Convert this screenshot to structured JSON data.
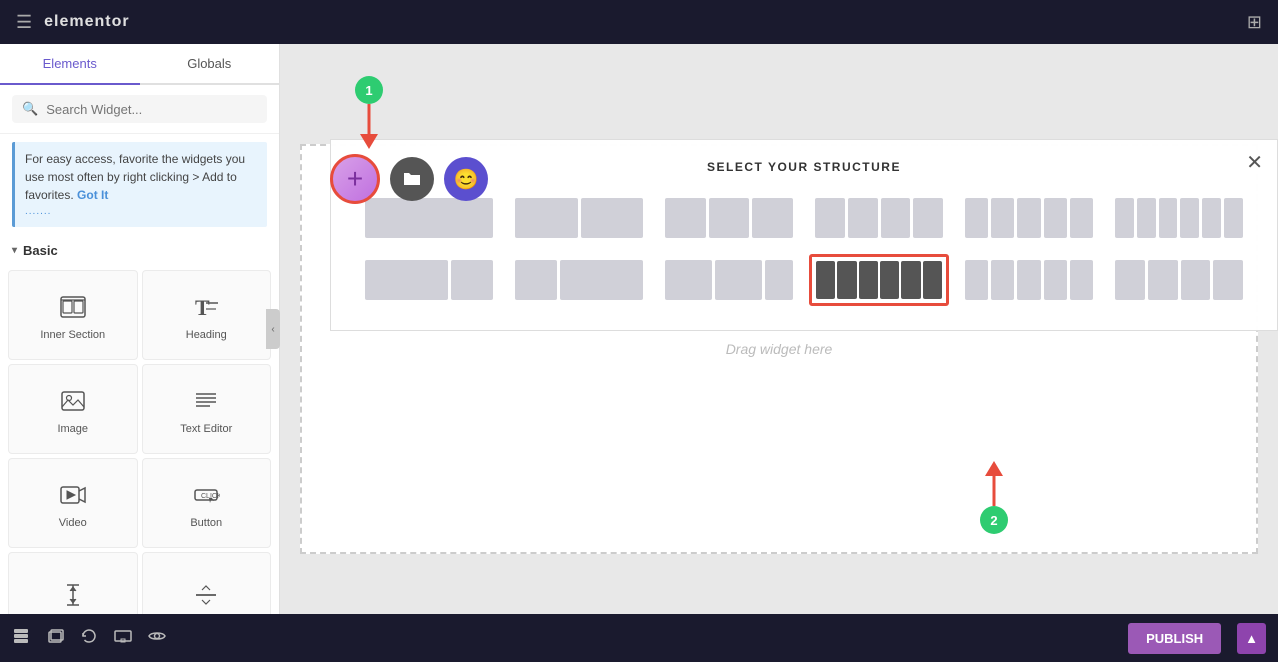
{
  "topbar": {
    "title": "elementor",
    "hamburger_icon": "☰",
    "grid_icon": "⊞"
  },
  "sidebar": {
    "tabs": [
      {
        "label": "Elements",
        "active": true
      },
      {
        "label": "Globals",
        "active": false
      }
    ],
    "search": {
      "placeholder": "Search Widget...",
      "value": ""
    },
    "info_box": {
      "text": "For easy access, favorite the widgets you use most often by right clicking > Add to favorites.",
      "got_it_label": "Got It",
      "dots": "......."
    },
    "basic_section": {
      "label": "Basic",
      "expanded": true
    },
    "widgets": [
      {
        "id": "inner-section",
        "label": "Inner Section",
        "icon_type": "inner-section"
      },
      {
        "id": "heading",
        "label": "Heading",
        "icon_type": "heading"
      },
      {
        "id": "image",
        "label": "Image",
        "icon_type": "image"
      },
      {
        "id": "text-editor",
        "label": "Text Editor",
        "icon_type": "text-editor"
      },
      {
        "id": "video",
        "label": "Video",
        "icon_type": "video"
      },
      {
        "id": "button",
        "label": "Button",
        "icon_type": "button"
      },
      {
        "id": "spacer1",
        "label": "",
        "icon_type": "spacer"
      },
      {
        "id": "spacer2",
        "label": "",
        "icon_type": "spacer2"
      }
    ]
  },
  "bottom_toolbar": {
    "icons": [
      "layers",
      "stack",
      "history",
      "responsive",
      "eye"
    ],
    "publish_label": "PUBLISH",
    "chevron_up": "▲"
  },
  "canvas": {
    "drop_zone_text": "Drag widget here",
    "add_buttons": [
      {
        "type": "plus",
        "aria": "Add element"
      },
      {
        "type": "folder",
        "aria": "Templates"
      },
      {
        "type": "emoji",
        "aria": "Theme builder"
      }
    ],
    "annotation_1": "1",
    "annotation_2": "2",
    "structure_panel": {
      "title": "SELECT YOUR STRUCTURE",
      "close_icon": "✕",
      "structures": [
        {
          "cols": [
            1
          ],
          "selected": false
        },
        {
          "cols": [
            1,
            1
          ],
          "selected": false
        },
        {
          "cols": [
            1,
            1,
            1
          ],
          "selected": false
        },
        {
          "cols": [
            1,
            1,
            1,
            1
          ],
          "selected": false
        },
        {
          "cols": [
            1,
            1,
            1,
            1,
            1
          ],
          "selected": false
        },
        {
          "cols": [
            1,
            1,
            1,
            1,
            1,
            1
          ],
          "selected": false
        },
        {
          "cols": [
            2,
            1
          ],
          "selected": false
        },
        {
          "cols": [
            1,
            2
          ],
          "selected": false
        },
        {
          "cols": [
            1,
            1,
            0.5
          ],
          "selected": false
        },
        {
          "cols": [
            1,
            1,
            1,
            1,
            1,
            1
          ],
          "selected": true
        },
        {
          "cols": [
            1,
            1,
            1,
            1,
            1
          ],
          "selected": false
        },
        {
          "cols": [
            1,
            1,
            1,
            1
          ],
          "selected": false
        }
      ]
    }
  }
}
